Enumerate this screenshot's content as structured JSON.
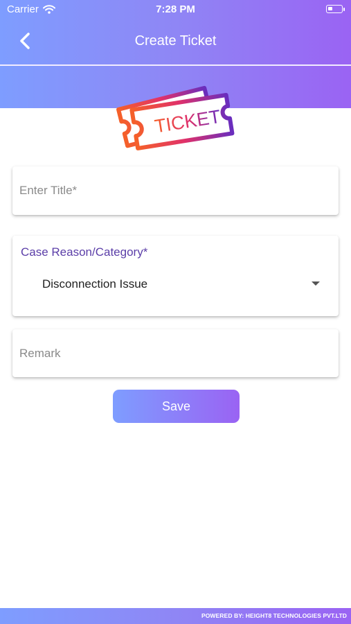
{
  "status_bar": {
    "carrier": "Carrier",
    "time": "7:28 PM"
  },
  "nav": {
    "title": "Create Ticket"
  },
  "logo": {
    "text": "TICKET"
  },
  "form": {
    "title_placeholder": "Enter Title*",
    "title_value": "",
    "category_label": "Case Reason/Category*",
    "category_value": "Disconnection Issue",
    "remark_placeholder": "Remark",
    "remark_value": ""
  },
  "save_label": "Save",
  "footer": {
    "text": "POWERED BY: HEIGHT8 TECHNOLOGIES PVT.LTD"
  },
  "colors": {
    "gradient_start": "#7e9dff",
    "gradient_end": "#9a63f3",
    "category_label": "#5b3ea8"
  }
}
